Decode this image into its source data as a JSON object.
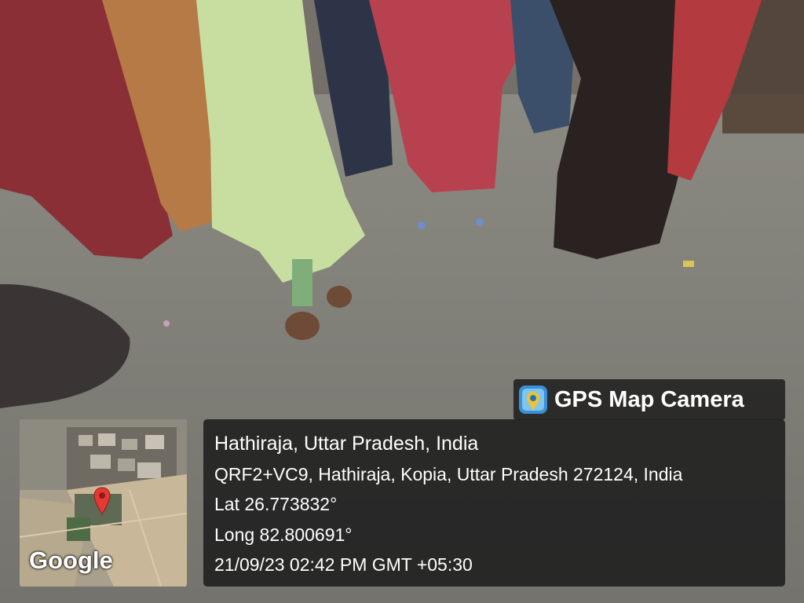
{
  "app": {
    "name": "GPS Map Camera",
    "icon": "camera-pin-icon"
  },
  "map": {
    "attribution": "Google",
    "marker": "location-pin-icon"
  },
  "location": {
    "place": "Hathiraja, Uttar Pradesh, India",
    "address": "QRF2+VC9, Hathiraja, Kopia, Uttar Pradesh 272124, India",
    "lat": "Lat 26.773832°",
    "long": "Long 82.800691°",
    "timestamp": "21/09/23 02:42 PM GMT +05:30"
  },
  "colors": {
    "panel_bg": "#1e1e1e",
    "text": "#ffffff",
    "pin": "#e53935"
  }
}
